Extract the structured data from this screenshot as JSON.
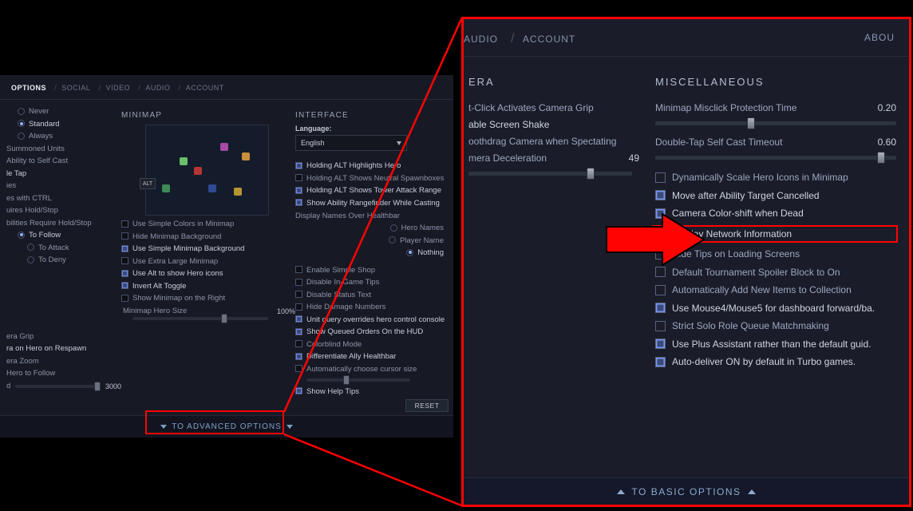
{
  "left": {
    "tabs": [
      "OPTIONS",
      "SOCIAL",
      "VIDEO",
      "AUDIO",
      "ACCOUNT"
    ],
    "active_tab_index": 0,
    "col1_top_radios": {
      "never": "Never",
      "standard": "Standard",
      "always": "Always",
      "selected": "standard"
    },
    "col1_items": [
      "Summoned Units",
      "Ability to Self Cast",
      "le Tap",
      "ies",
      "es with CTRL",
      "uires Hold/Stop",
      "bilities Require Hold/Stop",
      "To Follow",
      "To Attack",
      "To Deny"
    ],
    "camera_items": [
      "era Grip",
      "ra on Hero on Respawn",
      "era Zoom",
      "Hero to Follow"
    ],
    "camera_slider": {
      "label": "d",
      "value": "3000",
      "pct": 100
    },
    "minimap_hdr": "MINIMAP",
    "minimap_alt": "ALT",
    "minimap_checks": [
      {
        "label": "Use Simple Colors in Minimap",
        "on": false,
        "bright": false
      },
      {
        "label": "Hide Minimap Background",
        "on": false,
        "bright": false
      },
      {
        "label": "Use Simple Minimap Background",
        "on": true,
        "bright": true
      },
      {
        "label": "Use Extra Large Minimap",
        "on": false,
        "bright": false
      },
      {
        "label": "Use Alt to show Hero icons",
        "on": true,
        "bright": true
      },
      {
        "label": "Invert Alt Toggle",
        "on": true,
        "bright": true
      },
      {
        "label": "Show Minimap on the Right",
        "on": false,
        "bright": false
      }
    ],
    "minimap_size": {
      "label": "Minimap Hero Size",
      "value": "100%",
      "pct": 65
    },
    "interface_hdr": "INTERFACE",
    "lang_label": "Language:",
    "lang_value": "English",
    "interface_checks_a": [
      {
        "label": "Holding ALT Highlights Hero",
        "on": true,
        "bright": true
      },
      {
        "label": "Holding ALT Shows Neutral Spawnboxes",
        "on": false,
        "bright": false
      },
      {
        "label": "Holding ALT Shows Tower Attack Range",
        "on": true,
        "bright": true
      },
      {
        "label": "Show Ability Rangefinder While Casting",
        "on": true,
        "bright": true
      }
    ],
    "names_label": "Display Names Over Healthbar",
    "names_options": [
      "Hero Names",
      "Player Name",
      "Nothing"
    ],
    "names_selected": 2,
    "interface_checks_b": [
      {
        "label": "Enable Simple Shop",
        "on": false,
        "bright": false
      },
      {
        "label": "Disable In-Game Tips",
        "on": false,
        "bright": false
      },
      {
        "label": "Disable Status Text",
        "on": false,
        "bright": false
      },
      {
        "label": "Hide Damage Numbers",
        "on": false,
        "bright": false
      },
      {
        "label": "Unit query overrides hero control console",
        "on": true,
        "bright": true
      },
      {
        "label": "Show Queued Orders On the HUD",
        "on": true,
        "bright": true
      },
      {
        "label": "Colorblind Mode",
        "on": false,
        "bright": false
      },
      {
        "label": "Differentiate Ally Healthbar",
        "on": true,
        "bright": true
      },
      {
        "label": "Automatically choose cursor size",
        "on": false,
        "bright": false
      }
    ],
    "cursor_slider_pct": 35,
    "show_help_label": "Show Help Tips",
    "reset_label": "RESET",
    "adv_link": "TO ADVANCED OPTIONS"
  },
  "right": {
    "tabs": [
      "AUDIO",
      "ACCOUNT"
    ],
    "about": "ABOU",
    "camera_hdr": "ERA",
    "camera_lines": [
      "t-Click Activates Camera Grip",
      "able Screen Shake",
      "oothdrag Camera when Spectating"
    ],
    "camera_decel": {
      "label": "mera Deceleration",
      "value": "49",
      "pct": 72
    },
    "misc_hdr": "MISCELLANEOUS",
    "misc_sliders": [
      {
        "label": "Minimap Misclick Protection Time",
        "value": "0.20",
        "pct": 38
      },
      {
        "label": "Double-Tap Self Cast Timeout",
        "value": "0.60",
        "pct": 92
      }
    ],
    "misc_checks": [
      {
        "label": "Dynamically Scale Hero Icons in Minimap",
        "on": false,
        "bright": false,
        "hl": false
      },
      {
        "label": "Move after Ability Target Cancelled",
        "on": true,
        "bright": true,
        "hl": false
      },
      {
        "label": "Camera Color-shift when Dead",
        "on": true,
        "bright": true,
        "hl": false
      },
      {
        "label": "Display Network Information",
        "on": true,
        "bright": true,
        "hl": true
      },
      {
        "label": "Hide Tips on Loading Screens",
        "on": false,
        "bright": false,
        "hl": false
      },
      {
        "label": "Default Tournament Spoiler Block to On",
        "on": false,
        "bright": false,
        "hl": false
      },
      {
        "label": "Automatically Add New Items to Collection",
        "on": false,
        "bright": false,
        "hl": false
      },
      {
        "label": "Use Mouse4/Mouse5 for dashboard forward/ba.",
        "on": true,
        "bright": true,
        "hl": false
      },
      {
        "label": "Strict Solo Role Queue Matchmaking",
        "on": false,
        "bright": false,
        "hl": false
      },
      {
        "label": "Use Plus Assistant rather than the default guid.",
        "on": true,
        "bright": true,
        "hl": false
      },
      {
        "label": "Auto-deliver ON by default in Turbo games.",
        "on": true,
        "bright": true,
        "hl": false
      }
    ],
    "to_basic": "TO BASIC OPTIONS"
  }
}
